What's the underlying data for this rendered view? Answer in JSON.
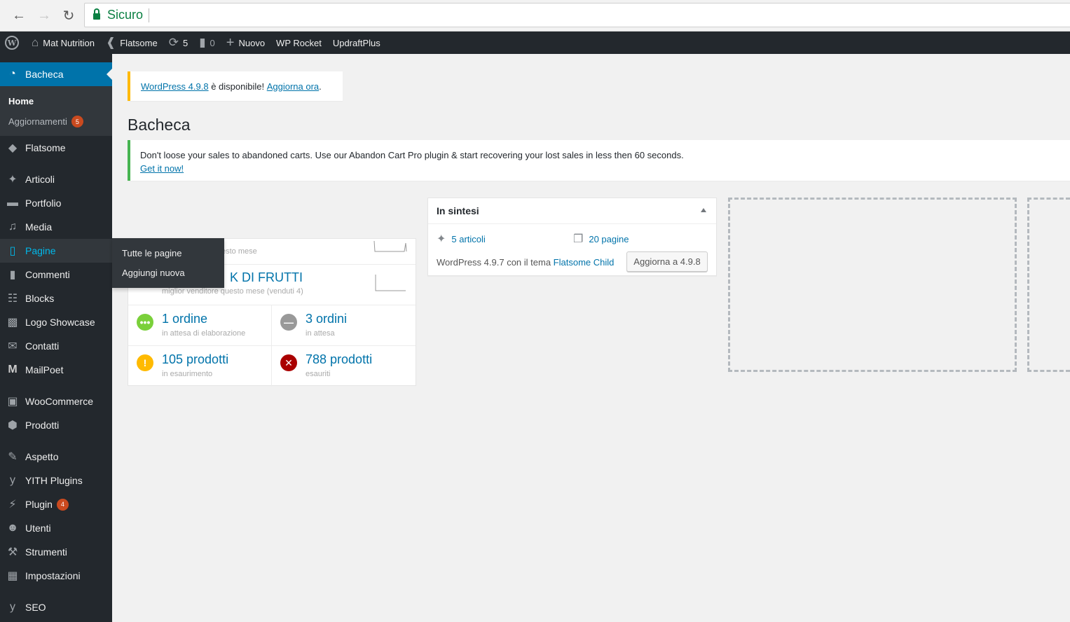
{
  "browser": {
    "secure_label": "Sicuro"
  },
  "adminbar": {
    "site_name": "Mat Nutrition",
    "theme": "Flatsome",
    "updates_count": "5",
    "comments_count": "0",
    "new_label": "Nuovo",
    "wp_rocket": "WP Rocket",
    "updraft": "UpdraftPlus"
  },
  "sidebar": {
    "dashboard": "Bacheca",
    "home": "Home",
    "updates": "Aggiornamenti",
    "updates_badge": "5",
    "flatsome": "Flatsome",
    "posts": "Articoli",
    "portfolio": "Portfolio",
    "media": "Media",
    "pages": "Pagine",
    "comments": "Commenti",
    "blocks": "Blocks",
    "logo_showcase": "Logo Showcase",
    "contacts": "Contatti",
    "mailpoet": "MailPoet",
    "woocommerce": "WooCommerce",
    "products": "Prodotti",
    "appearance": "Aspetto",
    "yith": "YITH Plugins",
    "plugins": "Plugin",
    "plugins_badge": "4",
    "users": "Utenti",
    "tools": "Strumenti",
    "settings": "Impostazioni",
    "seo": "SEO"
  },
  "flyout": {
    "all_pages": "Tutte le pagine",
    "add_new": "Aggiungi nuova"
  },
  "update_nag": {
    "version_link": "WordPress 4.9.8",
    "text": " è disponibile! ",
    "update_link": "Aggiorna ora",
    "end": "."
  },
  "page_title": "Bacheca",
  "notice": {
    "text": "Don't loose your sales to abandoned carts. Use our Abandon Cart Pro plugin & start recovering your lost sales in less then 60 seconds.",
    "link": "Get it now!"
  },
  "wc_status": {
    "row1_sub": "esto mese",
    "best_seller": "K DI FRUTTI",
    "best_seller_sub": "miglior venditore questo mese (venduti 4)",
    "processing_big": "1 ordine",
    "processing_small": "in attesa di elaborazione",
    "onhold_big": "3 ordini",
    "onhold_small": "in attesa",
    "lowstock_big": "105 prodotti",
    "lowstock_small": "in esaurimento",
    "outstock_big": "788 prodotti",
    "outstock_small": "esauriti",
    "colors": {
      "processing": "#7ad03a",
      "onhold": "#999999",
      "lowstock": "#ffba00",
      "outstock": "#aa0000"
    }
  },
  "glance": {
    "title": "In sintesi",
    "posts": "5 articoli",
    "pages": "20 pagine",
    "version_text": "WordPress 4.9.7 con il tema ",
    "theme_link": "Flatsome Child",
    "upgrade_button": "Aggiorna a 4.9.8"
  }
}
